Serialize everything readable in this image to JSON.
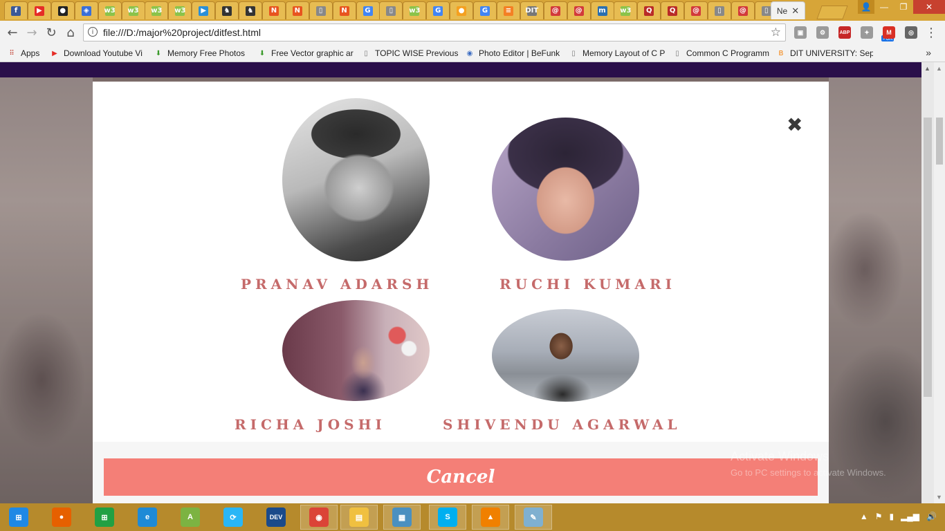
{
  "browser": {
    "active_tab_title": "Ne",
    "url": "file:///D:/major%20project/ditfest.html",
    "tab_favicons": [
      {
        "name": "facebook-tab",
        "glyph": "f",
        "color": "#3b5998"
      },
      {
        "name": "youtube-tab",
        "glyph": "▶",
        "color": "#e52d27"
      },
      {
        "name": "github-tab",
        "glyph": "●",
        "color": "#222222"
      },
      {
        "name": "link-tab",
        "glyph": "◈",
        "color": "#3a6fd8"
      },
      {
        "name": "w3schools-tab",
        "glyph": "w3",
        "color": "#8bc34a"
      },
      {
        "name": "w3schools-tab",
        "glyph": "w3",
        "color": "#8bc34a"
      },
      {
        "name": "w3schools-tab",
        "glyph": "w3",
        "color": "#8bc34a"
      },
      {
        "name": "w3schools-tab",
        "glyph": "w3",
        "color": "#8bc34a"
      },
      {
        "name": "play-tab",
        "glyph": "▶",
        "color": "#2a8fd8"
      },
      {
        "name": "tab-dark",
        "glyph": "♞",
        "color": "#333333"
      },
      {
        "name": "tab-dark",
        "glyph": "♞",
        "color": "#333333"
      },
      {
        "name": "n-tab",
        "glyph": "N",
        "color": "#e8541f"
      },
      {
        "name": "n-tab",
        "glyph": "N",
        "color": "#e8541f"
      },
      {
        "name": "doc-tab",
        "glyph": "▯",
        "color": "#888888"
      },
      {
        "name": "n-tab",
        "glyph": "N",
        "color": "#e8541f"
      },
      {
        "name": "google-tab",
        "glyph": "G",
        "color": "#4285f4"
      },
      {
        "name": "doc-tab",
        "glyph": "▯",
        "color": "#888888"
      },
      {
        "name": "w3schools-tab",
        "glyph": "w3",
        "color": "#8bc34a"
      },
      {
        "name": "google-tab",
        "glyph": "G",
        "color": "#4285f4"
      },
      {
        "name": "orange-tab",
        "glyph": "●",
        "color": "#f4a020"
      },
      {
        "name": "google-tab",
        "glyph": "G",
        "color": "#4285f4"
      },
      {
        "name": "stack-tab",
        "glyph": "≡",
        "color": "#f48024"
      },
      {
        "name": "dit-tab",
        "glyph": "DIT",
        "color": "#777777"
      },
      {
        "name": "swirl-tab",
        "glyph": "@",
        "color": "#d23a3a"
      },
      {
        "name": "swirl-tab",
        "glyph": "@",
        "color": "#d23a3a"
      },
      {
        "name": "m-tab",
        "glyph": "m",
        "color": "#2a6fb0"
      },
      {
        "name": "w3schools-tab",
        "glyph": "w3",
        "color": "#8bc34a"
      },
      {
        "name": "quora-tab",
        "glyph": "Q",
        "color": "#b92b27"
      },
      {
        "name": "quora-tab",
        "glyph": "Q",
        "color": "#b92b27"
      },
      {
        "name": "swirl-tab",
        "glyph": "@",
        "color": "#d23a3a"
      },
      {
        "name": "doc-tab",
        "glyph": "▯",
        "color": "#888888"
      },
      {
        "name": "swirl-tab",
        "glyph": "@",
        "color": "#d23a3a"
      },
      {
        "name": "doc-tab",
        "glyph": "▯",
        "color": "#888888"
      }
    ],
    "bookmarks": [
      {
        "label": "Apps",
        "icon": "apps-icon"
      },
      {
        "label": "Download Youtube Vi",
        "icon": "youtube-icon"
      },
      {
        "label": "Memory Free Photos",
        "icon": "download-arrow-icon"
      },
      {
        "label": "Free Vector graphic ar",
        "icon": "download-arrow-icon"
      },
      {
        "label": "TOPIC WISE Previous",
        "icon": "page-icon"
      },
      {
        "label": "Photo Editor | BeFunk",
        "icon": "befunky-icon"
      },
      {
        "label": "Memory Layout of C P",
        "icon": "page-icon"
      },
      {
        "label": "Common C Programm",
        "icon": "page-icon"
      },
      {
        "label": "DIT UNIVERSITY: Sept",
        "icon": "blogger-icon"
      }
    ],
    "more_bookmarks": "»",
    "extensions": [
      {
        "name": "ext-gray-icon",
        "glyph": "▣",
        "color": "#9a9a9a"
      },
      {
        "name": "ext-gear-icon",
        "glyph": "⚙",
        "color": "#9a9a9a"
      },
      {
        "name": "adblock-icon",
        "glyph": "ABP",
        "color": "#c62828"
      },
      {
        "name": "ext-puzzle-icon",
        "glyph": "✦",
        "color": "#9a9a9a"
      },
      {
        "name": "gmail-icon",
        "glyph": "M",
        "color": "#d93025"
      },
      {
        "name": "ext-globe-icon",
        "glyph": "◎",
        "color": "#666666"
      }
    ],
    "gmail_badge": ">6K"
  },
  "modal": {
    "close_glyph": "✖",
    "members": [
      {
        "name": "PRANAV ADARSH"
      },
      {
        "name": "RUCHI KUMARI"
      },
      {
        "name": "RICHA JOSHI"
      },
      {
        "name": "SHIVENDU AGARWAL"
      }
    ],
    "cancel_label": "Cancel"
  },
  "watermark": {
    "title": "Activate Windows",
    "subtitle": "Go to PC settings to activate Windows."
  },
  "taskbar": {
    "items": [
      {
        "name": "start-button",
        "glyph": "⊞",
        "color": "#1e88e5"
      },
      {
        "name": "firefox-icon",
        "glyph": "●",
        "color": "#e66000"
      },
      {
        "name": "store-icon",
        "glyph": "⊞",
        "color": "#21a043"
      },
      {
        "name": "ie-icon",
        "glyph": "e",
        "color": "#1e8ad6"
      },
      {
        "name": "android-studio-icon",
        "glyph": "A",
        "color": "#7cb342"
      },
      {
        "name": "sync-icon",
        "glyph": "⟳",
        "color": "#29b6f6"
      },
      {
        "name": "devcpp-icon",
        "glyph": "DEV",
        "color": "#1a4a8a"
      },
      {
        "name": "chrome-icon",
        "glyph": "◉",
        "color": "#db4437"
      },
      {
        "name": "explorer-icon",
        "glyph": "▤",
        "color": "#f0c040"
      },
      {
        "name": "photos-icon",
        "glyph": "▦",
        "color": "#4a90c0"
      },
      {
        "name": "skype-icon",
        "glyph": "S",
        "color": "#00aff0"
      },
      {
        "name": "vlc-icon",
        "glyph": "▲",
        "color": "#f08000"
      },
      {
        "name": "notepad-icon",
        "glyph": "✎",
        "color": "#7fb0d0"
      }
    ]
  }
}
